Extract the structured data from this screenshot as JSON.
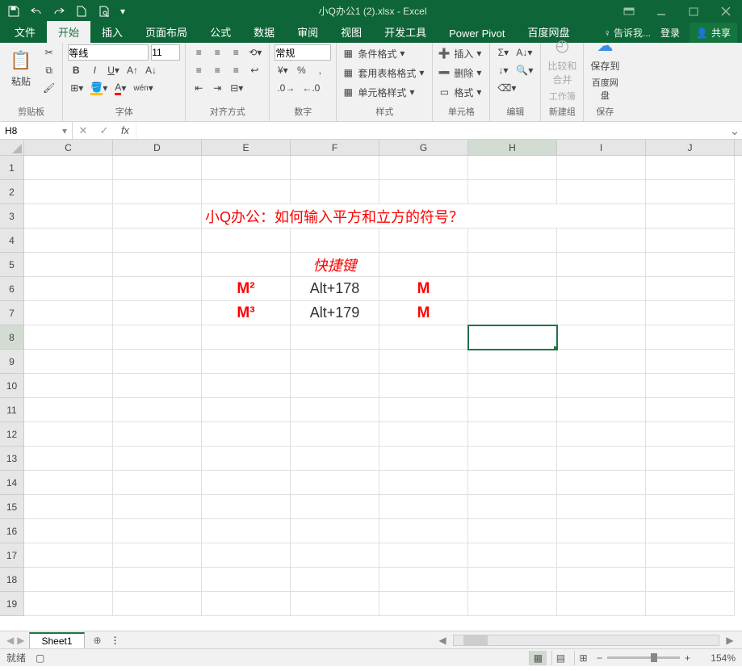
{
  "title": "小Q办公1 (2).xlsx - Excel",
  "qat": {
    "save": "保存",
    "undo": "撤销",
    "redo": "重做",
    "new": "新建",
    "preview": "打印预览"
  },
  "tabs": {
    "file": "文件",
    "home": "开始",
    "insert": "插入",
    "layout": "页面布局",
    "formulas": "公式",
    "data": "数据",
    "review": "审阅",
    "view": "视图",
    "devtools": "开发工具",
    "powerpivot": "Power Pivot",
    "baidu": "百度网盘"
  },
  "tell_me": "告诉我...",
  "login": "登录",
  "share": "共享",
  "ribbon": {
    "clipboard": {
      "label": "剪贴板",
      "paste": "粘贴"
    },
    "font": {
      "label": "字体",
      "name": "等线",
      "size": "11"
    },
    "align": {
      "label": "对齐方式"
    },
    "number": {
      "label": "数字",
      "format": "常规"
    },
    "styles": {
      "label": "样式",
      "cond": "条件格式",
      "table": "套用表格格式",
      "cell_style": "单元格样式"
    },
    "cells": {
      "label": "单元格",
      "insert": "插入",
      "delete": "删除",
      "format": "格式"
    },
    "editing": {
      "label": "编辑"
    },
    "newgroup": {
      "label": "新建组",
      "compare": "比较和合并",
      "wb": "工作簿"
    },
    "save": {
      "label": "保存",
      "saveto": "保存到",
      "netdisk": "百度网盘"
    }
  },
  "namebox": "H8",
  "cols": [
    "C",
    "D",
    "E",
    "F",
    "G",
    "H",
    "I",
    "J"
  ],
  "rows": [
    "1",
    "2",
    "3",
    "4",
    "5",
    "6",
    "7",
    "8",
    "9",
    "10",
    "11",
    "12",
    "13",
    "14",
    "15",
    "16",
    "17",
    "18",
    "19"
  ],
  "cells": {
    "title_text": "小Q办公：如何输入平方和立方的符号？",
    "f5": "快捷键",
    "e6": "M²",
    "f6": "Alt+178",
    "g6": "M",
    "e7": "M³",
    "f7": "Alt+179",
    "g7": "M"
  },
  "sheets": {
    "s1": "Sheet1"
  },
  "status": {
    "ready": "就绪",
    "zoom": "154%"
  }
}
